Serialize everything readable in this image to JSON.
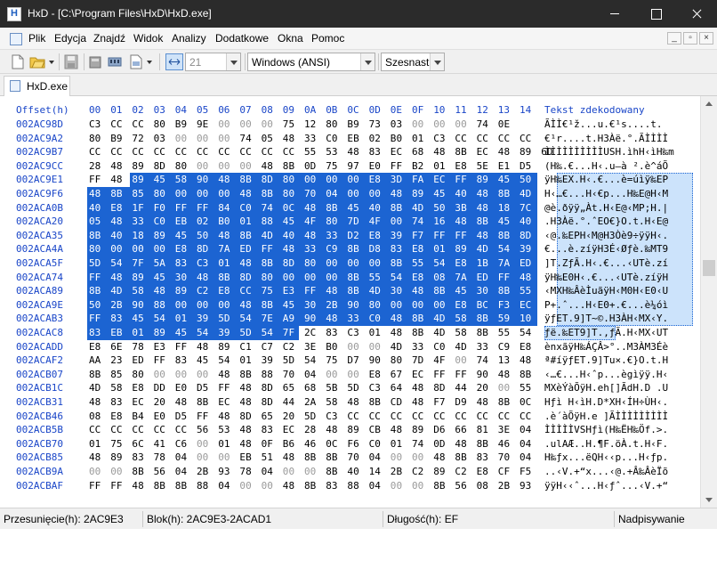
{
  "window": {
    "title": "HxD - [C:\\Program Files\\HxD\\HxD.exe]"
  },
  "menu": {
    "items": [
      "Plik",
      "Edycja",
      "Znajdź",
      "Widok",
      "Analizy",
      "Dodatkowe",
      "Okna",
      "Pomoc"
    ]
  },
  "toolbar": {
    "bytes_per_row": "21",
    "charset": "Windows (ANSI)",
    "offset_base": "Szesnastk"
  },
  "tabs": [
    {
      "label": "HxD.exe"
    }
  ],
  "editor": {
    "offset_header": "Offset(h)",
    "column_headers": [
      "00",
      "01",
      "02",
      "03",
      "04",
      "05",
      "06",
      "07",
      "08",
      "09",
      "0A",
      "0B",
      "0C",
      "0D",
      "0E",
      "0F",
      "10",
      "11",
      "12",
      "13",
      "14"
    ],
    "text_header": "Tekst zdekodowany",
    "rows": [
      {
        "offset": "002AC98D",
        "hex": "C3 CC CC 80 B9 9E 00 00 00 75 12 80 B9 73 03 00 00 00 74 0E",
        "text": "ÃÌÌ€¹ž...u.€¹s....t."
      },
      {
        "offset": "002AC9A2",
        "hex": "80 B9 72 03 00 00 00 74 05 48 33 C0 EB 02 B0 01 C3 CC CC CC CC",
        "text": "€¹r....t.H3Àë.°.ÃÌÌÌÌ"
      },
      {
        "offset": "002AC9B7",
        "hex": "CC CC CC CC CC CC CC CC CC CC 55 53 48 83 EC 68 48 8B EC 48 89 6D",
        "text": "ÌÌÌÌÌÌÌÌÌÌUSH.ìhH‹ìH‰m"
      },
      {
        "offset": "002AC9CC",
        "hex": "28 48 89 8D 80 00 00 00 48 8B 0D 75 97 E0 FF B2 01 E8 5E E1 D5",
        "text": "(H‰.€...H‹.u—à ².è^áÕ"
      },
      {
        "offset": "002AC9E1",
        "hex": "FF 48 89 45 58 90 48 8B 8D 80 00 00 00 E8 3D FA EC FF 89 45 50",
        "text": "ÿH‰EX.H‹.€...è=úìÿ‰EP"
      },
      {
        "offset": "002AC9F6",
        "hex": "48 8B 85 80 00 00 00 48 8B 80 70 04 00 00 48 89 45 40 48 8B 4D",
        "text": "H‹…€...H‹€p...H‰E@H‹M"
      },
      {
        "offset": "002ACA0B",
        "hex": "40 E8 1F F0 FF FF 84 C0 74 0C 48 8B 45 40 8B 4D 50 3B 48 18 7C",
        "text": "@è.ðÿÿ„Àt.H‹E@‹MP;H.|"
      },
      {
        "offset": "002ACA20",
        "hex": "05 48 33 C0 EB 02 B0 01 88 45 4F 80 7D 4F 00 74 16 48 8B 45 40",
        "text": ".H3Àë.°.ˆEO€}O.t.H‹E@"
      },
      {
        "offset": "002ACA35",
        "hex": "8B 40 18 89 45 50 48 8B 4D 40 48 33 D2 E8 39 F7 FF FF 48 8B 8D",
        "text": "‹@.‰EPH‹M@H3Òè9÷ÿÿH‹."
      },
      {
        "offset": "002ACA4A",
        "hex": "80 00 00 00 E8 8D 7A ED FF 48 33 C9 8B D8 83 E8 01 89 4D 54 39",
        "text": "€...è.zíÿH3É‹Øƒè.‰MT9"
      },
      {
        "offset": "002ACA5F",
        "hex": "5D 54 7F 5A 83 C3 01 48 8B 8D 80 00 00 00 8B 55 54 E8 1B 7A ED",
        "text": "]T.ZƒÃ.H‹.€...‹UTè.zí"
      },
      {
        "offset": "002ACA74",
        "hex": "FF 48 89 45 30 48 8B 8D 80 00 00 00 8B 55 54 E8 08 7A ED FF 48",
        "text": "ÿH‰E0H‹.€...‹UTè.zíÿH"
      },
      {
        "offset": "002ACA89",
        "hex": "8B 4D 58 48 89 C2 E8 CC 75 E3 FF 48 8B 4D 30 48 8B 45 30 8B 55",
        "text": "‹MXH‰ÂèÌuãÿH‹M0H‹E0‹U"
      },
      {
        "offset": "002ACA9E",
        "hex": "50 2B 90 88 00 00 00 48 8B 45 30 2B 90 80 00 00 00 E8 BC F3 EC",
        "text": "P+.ˆ...H‹E0+.€...è¼óì"
      },
      {
        "offset": "002ACAB3",
        "hex": "FF 83 45 54 01 39 5D 54 7E A9 90 48 33 C0 48 8B 4D 58 8B 59 10",
        "text": "ÿƒET.9]T~©.H3ÀH‹MX‹Y."
      },
      {
        "offset": "002ACAC8",
        "hex": "83 EB 01 89 45 54 39 5D 54 7F 2C 83 C3 01 48 8B 4D 58 8B 55 54",
        "text": "ƒë.‰ET9]T.,ƒÃ.H‹MX‹UT"
      },
      {
        "offset": "002ACADD",
        "hex": "E8 6E 78 E3 FF 48 89 C1 C7 C2 3E B0 00 00 4D 33 C0 4D 33 C9 E8",
        "text": "ènxãÿH‰ÁÇÂ>°..M3ÀM3Éè"
      },
      {
        "offset": "002ACAF2",
        "hex": "AA 23 ED FF 83 45 54 01 39 5D 54 75 D7 90 80 7D 4F 00 74 13 48",
        "text": "ª#íÿƒET.9]Tu×.€}O.t.H"
      },
      {
        "offset": "002ACB07",
        "hex": "8B 85 80 00 00 00 48 8B 88 70 04 00 00 E8 67 EC FF FF 90 48 8B",
        "text": "‹…€...H‹ˆp...ègìÿÿ.H‹"
      },
      {
        "offset": "002ACB1C",
        "hex": "4D 58 E8 DD E0 D5 FF 48 8D 65 68 5B 5D C3 64 48 8D 44 20 00 55",
        "text": "MXèÝàÕÿH.eh[]ÃdH.D .U"
      },
      {
        "offset": "002ACB31",
        "hex": "48 83 EC 20 48 8B EC 48 8D 44 2A 58 48 8B CD 48 F7 D9 48 8B 0C",
        "text": "Hƒì H‹ìH.D*XH‹ÍH÷ÙH‹."
      },
      {
        "offset": "002ACB46",
        "hex": "08 E8 B4 E0 D5 FF 48 8D 65 20 5D C3 CC CC CC CC CC CC CC CC CC",
        "text": ".è´àÕÿH.e ]ÃÌÌÌÌÌÌÌÌÌ"
      },
      {
        "offset": "002ACB5B",
        "hex": "CC CC CC CC CC 56 53 48 83 EC 28 48 89 CB 48 89 D6 66 81 3E 04",
        "text": "ÌÌÌÌÌVSHƒì(H‰ËH‰Öf.>."
      },
      {
        "offset": "002ACB70",
        "hex": "01 75 6C 41 C6 00 01 48 0F B6 46 0C F6 C0 01 74 0D 48 8B 46 04",
        "text": ".ulAÆ..H.¶F.öÀ.t.H‹F."
      },
      {
        "offset": "002ACB85",
        "hex": "48 89 83 78 04 00 00 EB 51 48 8B 8B 70 04 00 00 48 8B 83 70 04",
        "text": "H‰ƒx...ëQH‹‹p...H‹ƒp."
      },
      {
        "offset": "002ACB9A",
        "hex": "00 00 8B 56 04 2B 93 78 04 00 00 8B 40 14 2B C2 89 C2 E8 CF F5",
        "text": "..‹V.+“x...‹@.+Â‰ÂèÏõ"
      },
      {
        "offset": "002ACBAF",
        "hex": "FF FF 48 8B 8B 88 04 00 00 48 8B 83 88 04 00 00 8B 56 08 2B 93",
        "text": "ÿÿH‹‹ˆ...H‹ƒˆ...‹V.+“"
      }
    ]
  },
  "status": {
    "offset": "Przesunięcie(h): 2AC9E3",
    "block": "Blok(h): 2AC9E3-2ACAD1",
    "length": "Długość(h): EF",
    "mode": "Nadpisywanie"
  },
  "colors": {
    "titlebar": "#2b2b2b",
    "offset_blue": "#1a46c8",
    "byte_zero_gray": "#9a9a9a",
    "selection_hex": "#1c64d2",
    "selection_text": "#cce3fb"
  },
  "icons": [
    "app-icon",
    "new-file-icon",
    "open-folder-icon",
    "save-icon",
    "disk-icon",
    "ram-icon",
    "export-icon",
    "row-width-icon"
  ]
}
